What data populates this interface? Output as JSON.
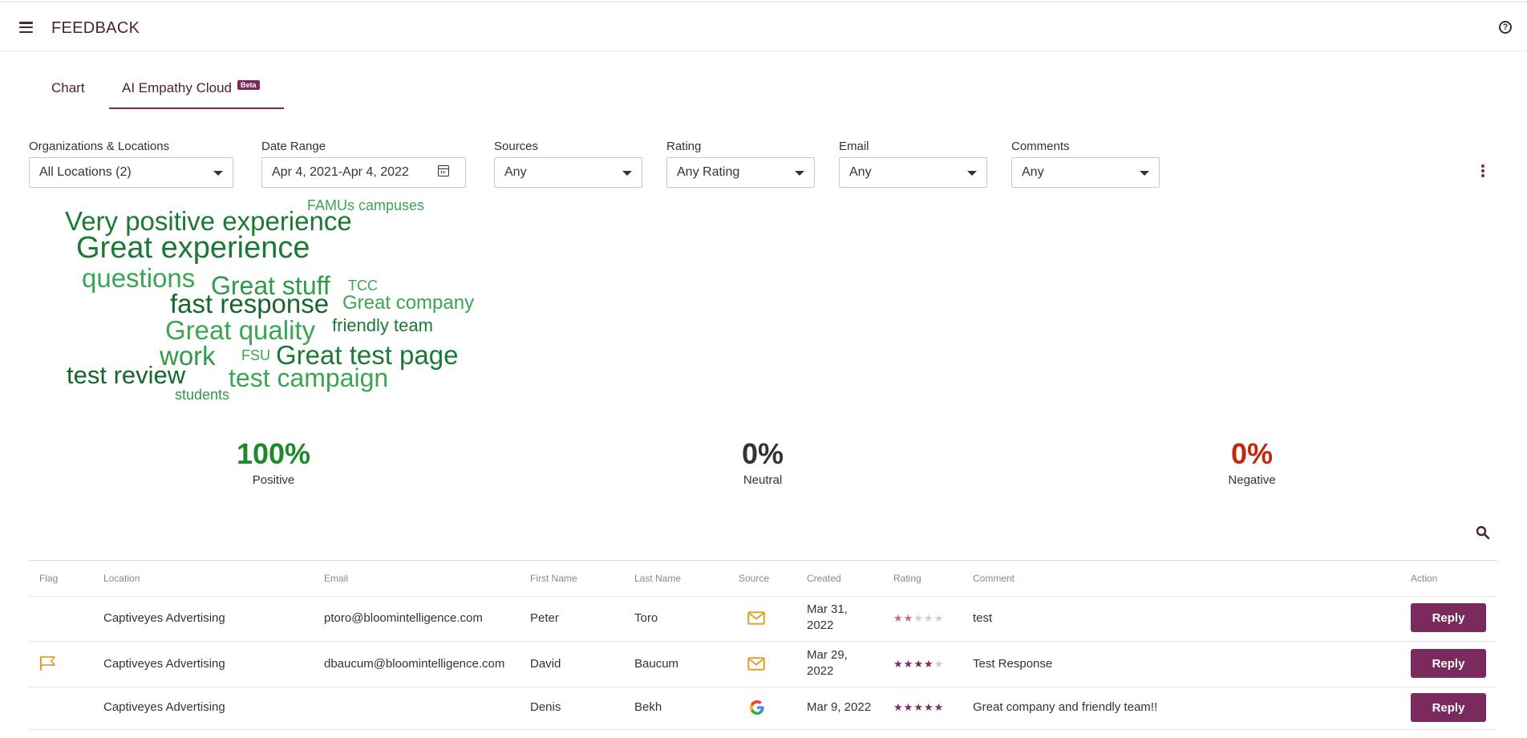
{
  "header": {
    "title": "FEEDBACK"
  },
  "tabs": [
    {
      "label": "Chart"
    },
    {
      "label": "AI Empathy Cloud",
      "badge": "Beta",
      "active": true
    }
  ],
  "filters": {
    "organizations": {
      "label": "Organizations & Locations",
      "value": "All Locations (2)"
    },
    "date_range": {
      "label": "Date Range",
      "value": "Apr 4, 2021-Apr 4, 2022"
    },
    "sources": {
      "label": "Sources",
      "value": "Any"
    },
    "rating": {
      "label": "Rating",
      "value": "Any Rating"
    },
    "email": {
      "label": "Email",
      "value": "Any"
    },
    "comments": {
      "label": "Comments",
      "value": "Any"
    }
  },
  "word_cloud": [
    "Very positive experience",
    "FAMUs campuses",
    "Great experience",
    "questions",
    "Great stuff",
    "TCC",
    "fast response",
    "Great company",
    "Great quality",
    "friendly team",
    "work",
    "FSU",
    "Great test page",
    "test review",
    "test campaign",
    "students"
  ],
  "sentiment": {
    "positive": {
      "value": "100%",
      "label": "Positive",
      "color": "#1a8a2a"
    },
    "neutral": {
      "value": "0%",
      "label": "Neutral",
      "color": "#333333"
    },
    "negative": {
      "value": "0%",
      "label": "Negative",
      "color": "#c0280f"
    }
  },
  "table": {
    "columns": [
      "Flag",
      "Location",
      "Email",
      "First Name",
      "Last Name",
      "Source",
      "Created",
      "Rating",
      "Comment",
      "Action"
    ],
    "rows": [
      {
        "flag": "",
        "location": "Captiveyes Advertising",
        "email": "ptoro@bloomintelligence.com",
        "first": "Peter",
        "last": "Toro",
        "source": "email-icon",
        "created_line1": "Mar 31,",
        "created_line2": "2022",
        "rating": 2,
        "comment": "test",
        "action": "Reply"
      },
      {
        "flag": "flag-icon",
        "location": "Captiveyes Advertising",
        "email": "dbaucum@bloomintelligence.com",
        "first": "David",
        "last": "Baucum",
        "source": "email-icon",
        "created_line1": "Mar 29,",
        "created_line2": "2022",
        "rating": 4,
        "comment": "Test Response",
        "action": "Reply"
      },
      {
        "flag": "",
        "location": "Captiveyes Advertising",
        "email": "",
        "first": "Denis",
        "last": "Bekh",
        "source": "google-icon",
        "created_line1": "Mar 9, 2022",
        "created_line2": "",
        "rating": 5,
        "comment": "Great company and friendly team!!",
        "action": "Reply"
      }
    ]
  },
  "colors": {
    "brand": "#7a2a5c",
    "title": "#4a2139",
    "email_icon": "#e0a030"
  }
}
